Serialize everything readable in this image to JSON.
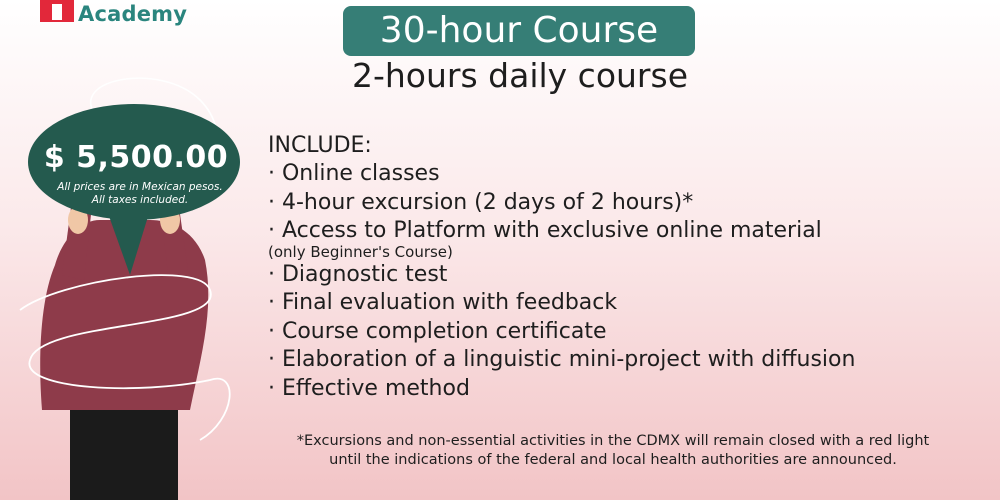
{
  "logo": {
    "text": "Academy",
    "icon": "academy-logo-icon"
  },
  "header": {
    "badge": "30-hour Course",
    "subtitle": "2-hours daily course"
  },
  "price": {
    "amount": "$ 5,500.00",
    "note_line1": "All prices are in Mexican pesos.",
    "note_line2": "All taxes included."
  },
  "includes": {
    "heading": "INCLUDE:",
    "items": [
      "· Online classes",
      "· 4-hour excursion (2 days of 2 hours)*",
      "· Access to Platform with exclusive online material",
      "(only Beginner's Course)",
      "· Diagnostic test",
      "· Final evaluation with feedback",
      "· Course completion certificate",
      "· Elaboration of a linguistic mini-project with diffusion",
      "· Effective method"
    ]
  },
  "footnote": {
    "line1": "*Excursions and non-essential activities in the CDMX will remain closed with a red light",
    "line2": "until the indications of the federal and local health authorities are announced."
  },
  "colors": {
    "accent": "#367e76",
    "bubble": "#245a4e",
    "sweater": "#8e3b4a",
    "brand_red": "#e2283a"
  }
}
